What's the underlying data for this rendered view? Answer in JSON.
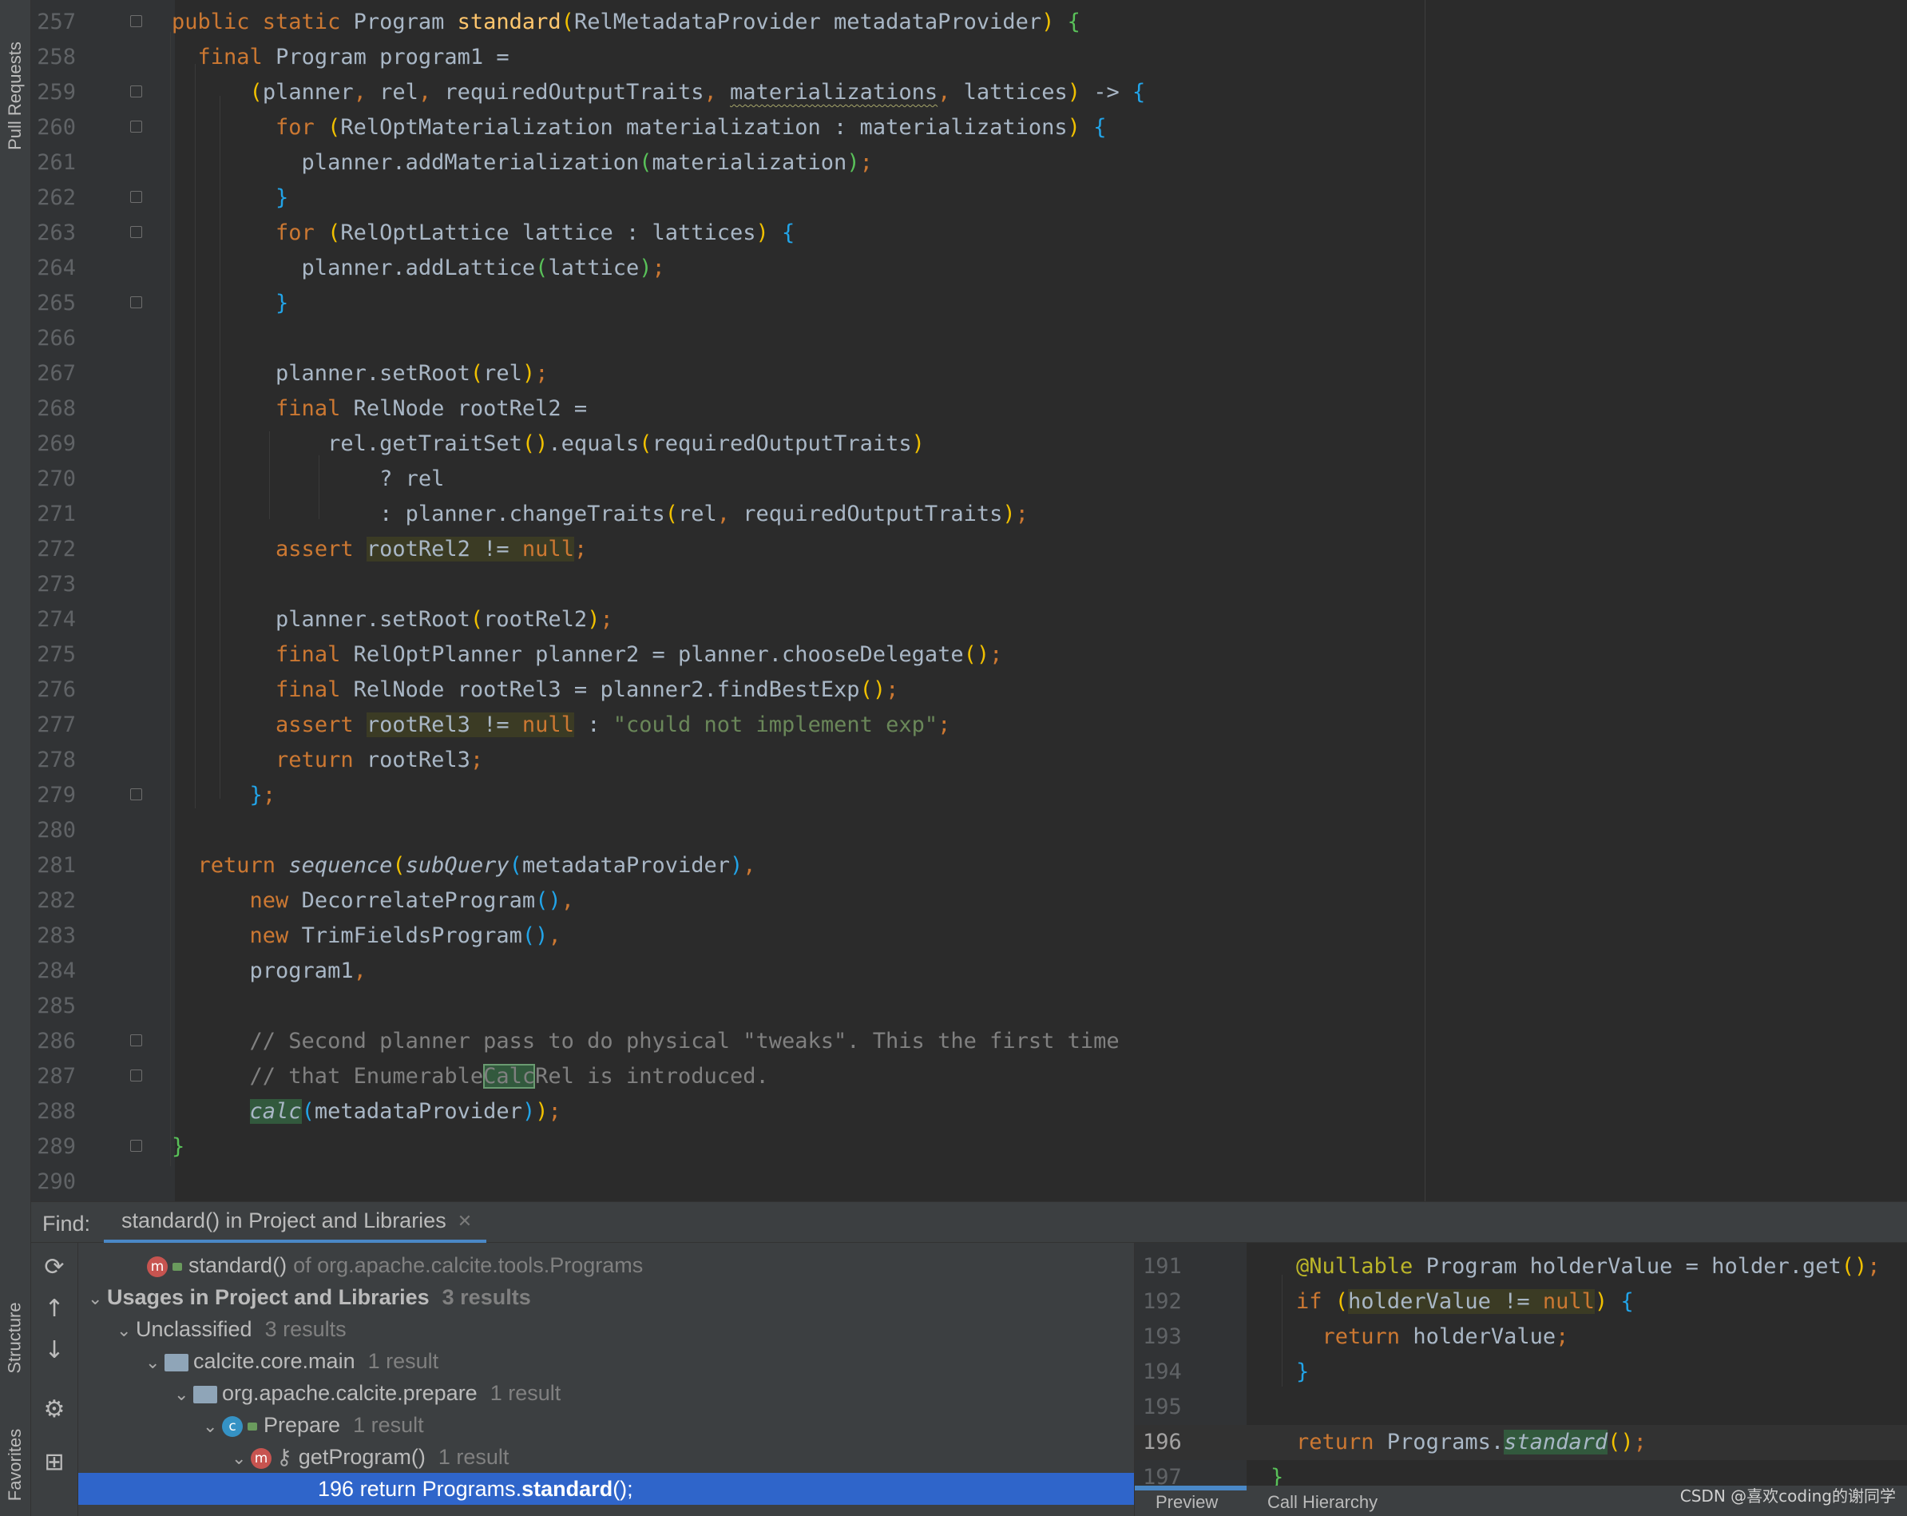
{
  "side_tabs": {
    "pull_requests": "Pull Requests",
    "structure": "Structure",
    "favorites": "Favorites"
  },
  "editor": {
    "line_numbers": [
      "257",
      "258",
      "259",
      "260",
      "261",
      "262",
      "263",
      "264",
      "265",
      "266",
      "267",
      "268",
      "269",
      "270",
      "271",
      "272",
      "273",
      "274",
      "275",
      "276",
      "277",
      "278",
      "279",
      "280",
      "281",
      "282",
      "283",
      "284",
      "285",
      "286",
      "287",
      "288",
      "289",
      "290"
    ],
    "source": {
      "l257": "public static Program standard(RelMetadataProvider metadataProvider) {",
      "l258": "final Program program1 =",
      "l259": "(planner, rel, requiredOutputTraits, materializations, lattices) -> {",
      "l260": "for (RelOptMaterialization materialization : materializations) {",
      "l261": "planner.addMaterialization(materialization);",
      "l262": "}",
      "l263": "for (RelOptLattice lattice : lattices) {",
      "l264": "planner.addLattice(lattice);",
      "l265": "}",
      "l267": "planner.setRoot(rel);",
      "l268": "final RelNode rootRel2 =",
      "l269": "rel.getTraitSet().equals(requiredOutputTraits)",
      "l270": "? rel",
      "l271": ": planner.changeTraits(rel, requiredOutputTraits);",
      "l272": "assert rootRel2 != null;",
      "l274": "planner.setRoot(rootRel2);",
      "l275": "final RelOptPlanner planner2 = planner.chooseDelegate();",
      "l276": "final RelNode rootRel3 = planner2.findBestExp();",
      "l277": "assert rootRel3 != null : \"could not implement exp\";",
      "l278": "return rootRel3;",
      "l279": "};",
      "l281": "return sequence(subQuery(metadataProvider),",
      "l282": "new DecorrelateProgram(),",
      "l283": "new TrimFieldsProgram(),",
      "l284": "program1,",
      "l286": "// Second planner pass to do physical \"tweaks\". This the first time",
      "l287": "// that EnumerableCalcRel is introduced.",
      "l288": "calc(metadataProvider));",
      "l289": "}"
    }
  },
  "find_panel": {
    "label": "Find:",
    "tab_title": "standard() in Project and Libraries",
    "tree": {
      "target": {
        "name": "standard()",
        "suffix": "of org.apache.calcite.tools.Programs"
      },
      "usages": {
        "label": "Usages in Project and Libraries",
        "count": "3 results"
      },
      "unclassified": {
        "label": "Unclassified",
        "count": "3 results"
      },
      "module": {
        "label": "calcite.core.main",
        "count": "1 result"
      },
      "package": {
        "label": "org.apache.calcite.prepare",
        "count": "1 result"
      },
      "class": {
        "label": "Prepare",
        "count": "1 result"
      },
      "method": {
        "label": "getProgram()",
        "count": "1 result"
      },
      "usage": {
        "line": "196",
        "pre": "return Programs.",
        "bold": "standard",
        "post": "();"
      }
    }
  },
  "preview": {
    "line_numbers": [
      "191",
      "192",
      "193",
      "194",
      "195",
      "196",
      "197"
    ],
    "source": {
      "l191": "@Nullable Program holderValue = holder.get();",
      "l192": "if (holderValue != null) {",
      "l193": "return holderValue;",
      "l194": "}",
      "l196": "return Programs.standard();",
      "l197": "}"
    },
    "tabs": [
      "Preview",
      "Call Hierarchy"
    ]
  },
  "watermark": "CSDN @喜欢coding的谢同学",
  "colors": {
    "background": "#2b2b2b",
    "keyword": "#cc7832",
    "method_decl": "#ffc66d",
    "string": "#6a8759",
    "comment": "#808080",
    "selection": "#2f65ca"
  }
}
